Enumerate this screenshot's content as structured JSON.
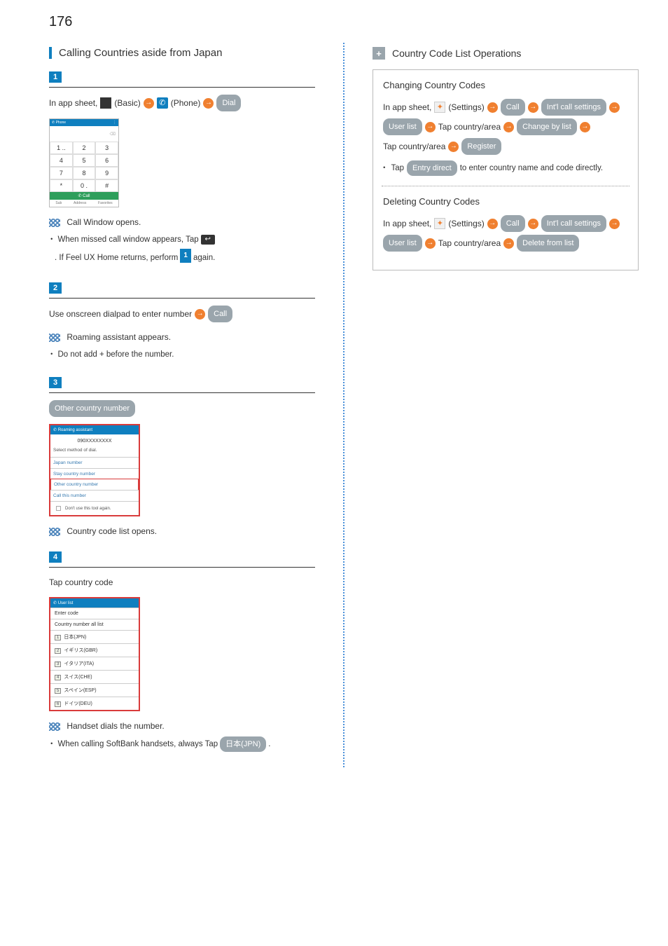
{
  "page_number": "176",
  "left": {
    "title": "Calling Countries aside from Japan",
    "step1": {
      "badge": "1",
      "flow_prefix": "In app sheet,",
      "basic": "(Basic)",
      "phone": "(Phone)",
      "dial_chip": "Dial",
      "shot": {
        "header_left": "Phone",
        "header_right": "",
        "blank_hint": "⌫",
        "keys": [
          "1 ..",
          "2",
          "3",
          "4",
          "5",
          "6",
          "7",
          "8",
          "9",
          "*",
          "0 .",
          "#"
        ],
        "call_label": "Call",
        "footer": [
          "Sub",
          "Address",
          "Favorites"
        ]
      },
      "result": "Call Window opens.",
      "note_a": "When missed call window appears, Tap",
      "note_b": ". If Feel UX Home returns, perform",
      "note_badge": "1",
      "note_c": "again."
    },
    "step2": {
      "badge": "2",
      "flow": "Use onscreen dialpad to enter number",
      "call_chip": "Call",
      "result": "Roaming assistant appears.",
      "note": "Do not add + before the number."
    },
    "step3": {
      "badge": "3",
      "chip": "Other country number",
      "shot": {
        "header": "Roaming assistant",
        "number": "090XXXXXXXX",
        "label": "Select method of dial.",
        "items": [
          "Japan number",
          "Stay country number",
          "Other country number",
          "Call this number"
        ],
        "selected_index": 2,
        "check_label": "Don't use this tool again."
      },
      "result": "Country code list opens."
    },
    "step4": {
      "badge": "4",
      "flow": "Tap country code",
      "shot": {
        "header": "User list",
        "top_items": [
          "Enter code",
          "Country number all list"
        ],
        "rows": [
          {
            "n": "1",
            "t": "日本(JPN)"
          },
          {
            "n": "2",
            "t": "イギリス(GBR)"
          },
          {
            "n": "3",
            "t": "イタリア(ITA)"
          },
          {
            "n": "4",
            "t": "スイス(CHE)"
          },
          {
            "n": "5",
            "t": "スペイン(ESP)"
          },
          {
            "n": "6",
            "t": "ドイツ(DEU)"
          }
        ]
      },
      "result": "Handset dials the number.",
      "note_a": "When calling SoftBank handsets, always Tap",
      "note_chip": "日本(JPN)",
      "note_b": "."
    }
  },
  "right": {
    "title": "Country Code List Operations",
    "op1": {
      "title": "Changing Country Codes",
      "prefix": "In app sheet,",
      "settings_label": "(Settings)",
      "chips": [
        "Call",
        "Int'l call settings",
        "User list"
      ],
      "tap1": "Tap country/area",
      "chips2": [
        "Change by list"
      ],
      "tap2": "Tap country/area",
      "chips3": [
        "Register"
      ],
      "note_a": "Tap",
      "note_chip": "Entry direct",
      "note_b": "to enter country name and code directly."
    },
    "op2": {
      "title": "Deleting Country Codes",
      "prefix": "In app sheet,",
      "settings_label": "(Settings)",
      "chips": [
        "Call",
        "Int'l call settings",
        "User list"
      ],
      "tap1": "Tap country/area",
      "chips2": [
        "Delete from list"
      ]
    }
  }
}
